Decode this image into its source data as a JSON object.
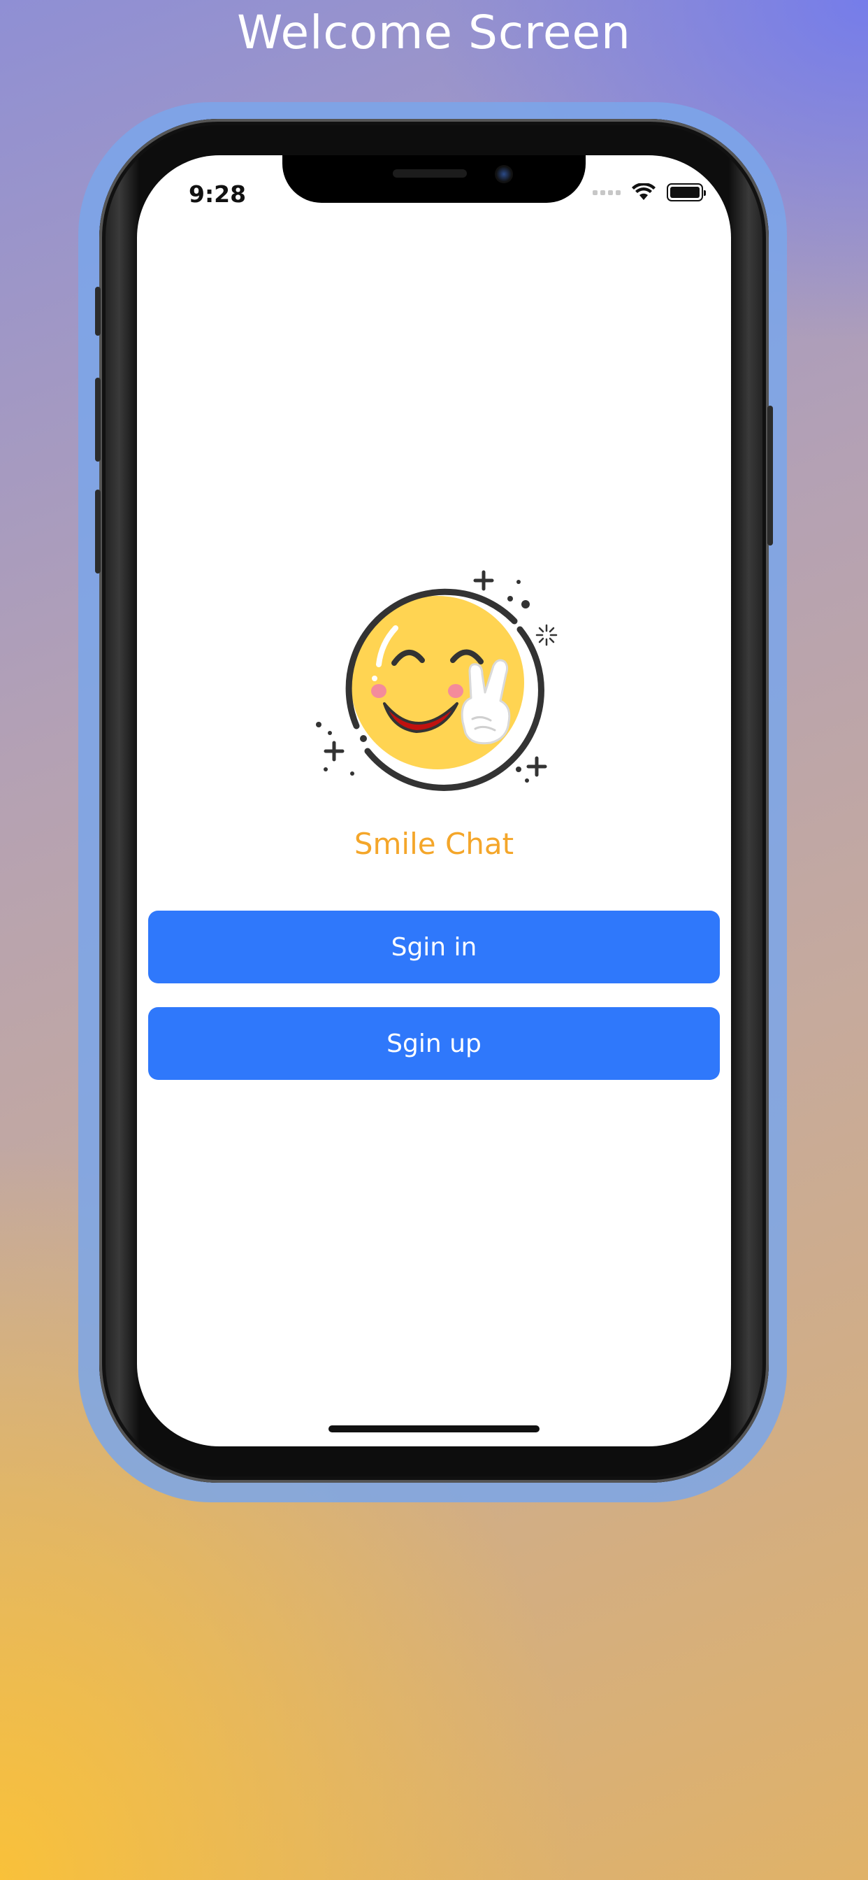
{
  "page": {
    "title": "Welcome Screen"
  },
  "status_bar": {
    "time": "9:28",
    "icons": [
      "cellular-signal-icon",
      "wifi-icon",
      "battery-icon"
    ]
  },
  "logo": {
    "icon": "smiley-peace-sign-icon"
  },
  "app": {
    "name": "Smile Chat"
  },
  "buttons": {
    "sign_in_label": "Sgin in",
    "sign_up_label": "Sgin up"
  },
  "colors": {
    "accent_button": "#2f78fb",
    "app_name": "#f4a62a",
    "smiley_face": "#ffd452"
  }
}
